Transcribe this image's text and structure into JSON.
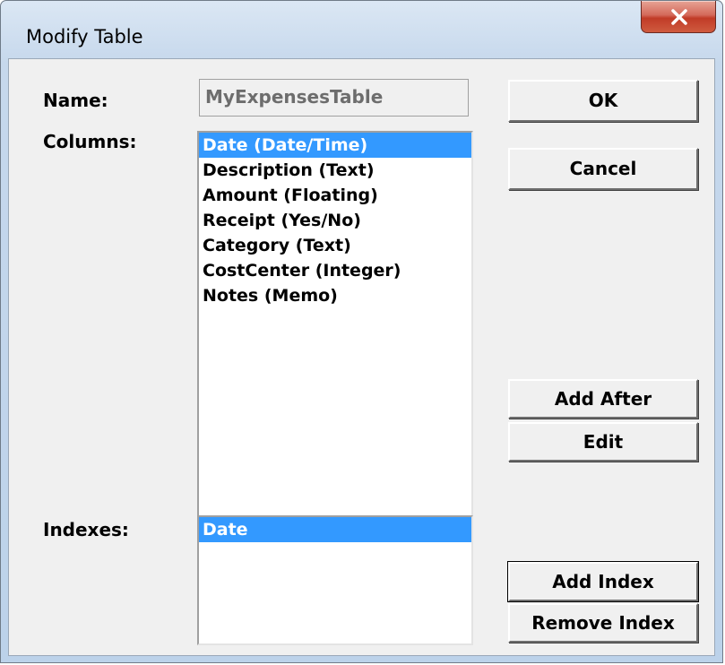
{
  "window": {
    "title": "Modify Table",
    "close_label": "x"
  },
  "form": {
    "name_label": "Name:",
    "name_value": "MyExpensesTable",
    "columns_label": "Columns:",
    "indexes_label": "Indexes:"
  },
  "columns": [
    {
      "label": "Date (Date/Time)",
      "selected": true
    },
    {
      "label": "Description (Text)",
      "selected": false
    },
    {
      "label": "Amount (Floating)",
      "selected": false
    },
    {
      "label": "Receipt (Yes/No)",
      "selected": false
    },
    {
      "label": "Category (Text)",
      "selected": false
    },
    {
      "label": "CostCenter (Integer)",
      "selected": false
    },
    {
      "label": "Notes (Memo)",
      "selected": false
    }
  ],
  "indexes": [
    {
      "label": "Date",
      "selected": true
    }
  ],
  "buttons": {
    "ok": "OK",
    "cancel": "Cancel",
    "add_after": "Add After",
    "edit": "Edit",
    "add_index": "Add Index",
    "remove_index": "Remove Index"
  },
  "colors": {
    "selection": "#3399ff",
    "dialog_bg": "#f0f0f0",
    "close_button": "#c13b27"
  }
}
